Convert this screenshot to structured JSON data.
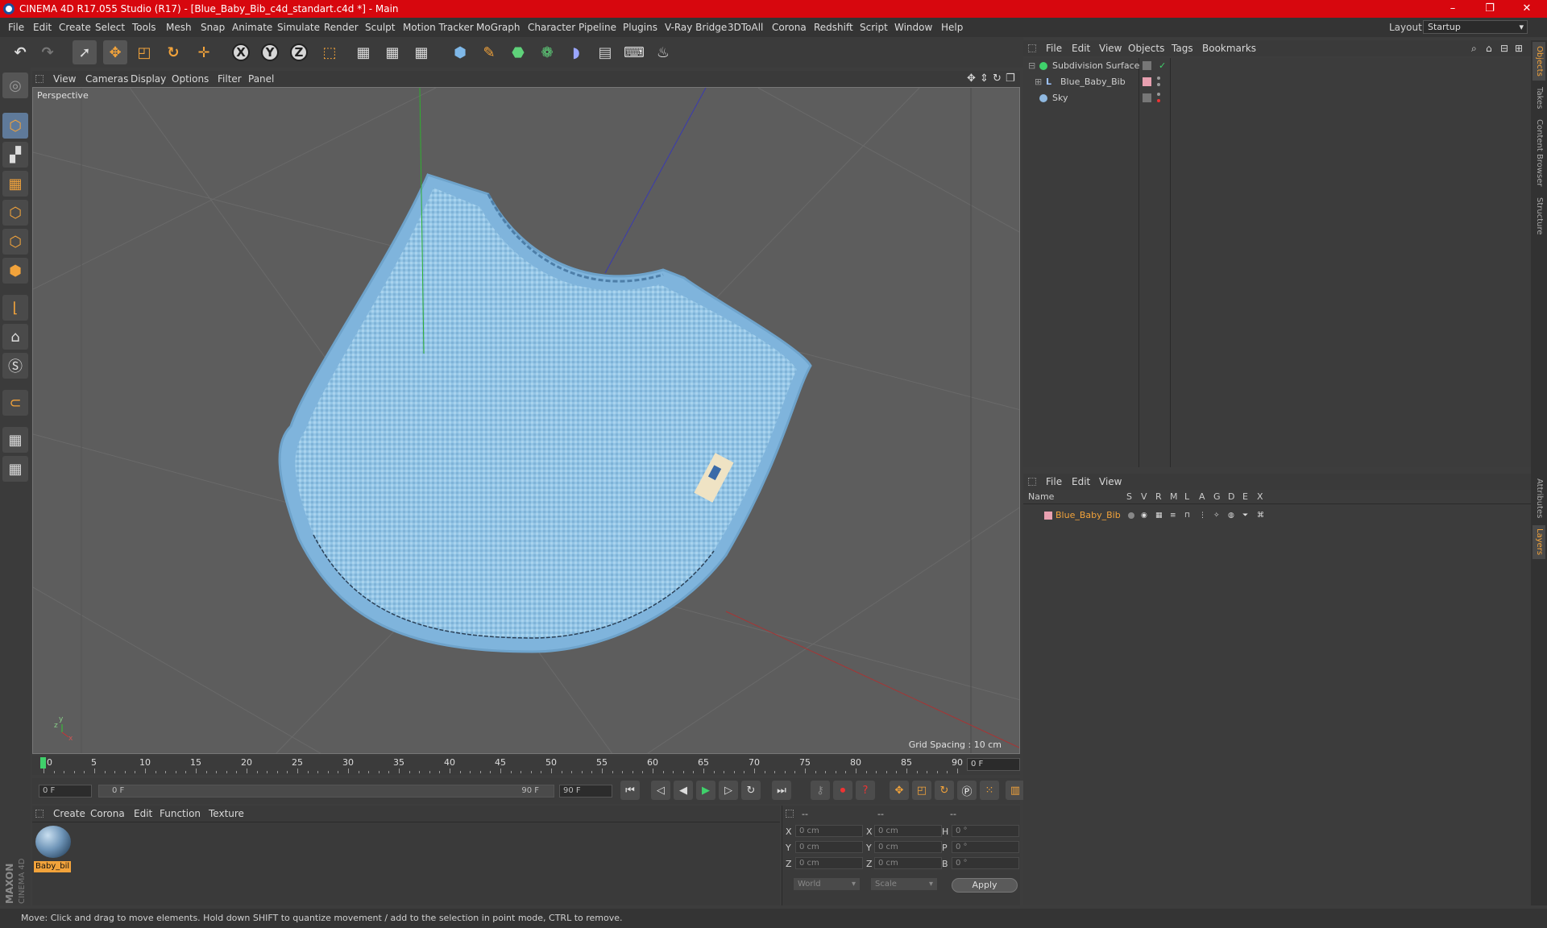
{
  "window": {
    "title": "CINEMA 4D R17.055 Studio (R17) - [Blue_Baby_Bib_c4d_standart.c4d *] - Main",
    "minimize": "–",
    "maximize": "❐",
    "close": "✕"
  },
  "menu": [
    "File",
    "Edit",
    "Create",
    "Select",
    "Tools",
    "Mesh",
    "Snap",
    "Animate",
    "Simulate",
    "Render",
    "Sculpt",
    "Motion Tracker",
    "MoGraph",
    "Character",
    "Pipeline",
    "Plugins",
    "V-Ray Bridge",
    "3DToAll",
    "Corona",
    "Redshift",
    "Script",
    "Window",
    "Help"
  ],
  "layout": {
    "label": "Layout:",
    "value": "Startup"
  },
  "toolbar": {
    "x_label": "X",
    "y_label": "Y",
    "z_label": "Z"
  },
  "viewport": {
    "menu": [
      "View",
      "Cameras",
      "Display",
      "Options",
      "Filter",
      "Panel"
    ],
    "label": "Perspective",
    "grid_spacing": "Grid Spacing : 10 cm"
  },
  "timeline": {
    "ticks": [
      "0",
      "5",
      "10",
      "15",
      "20",
      "25",
      "30",
      "35",
      "40",
      "45",
      "50",
      "55",
      "60",
      "65",
      "70",
      "75",
      "80",
      "85",
      "90"
    ],
    "current_frame": "0 F",
    "start": "0 F",
    "range_start": "0 F",
    "range_end": "90 F",
    "end": "90 F"
  },
  "material_manager": {
    "menu": [
      "Create",
      "Corona",
      "Edit",
      "Function",
      "Texture"
    ],
    "material_name": "Baby_bil"
  },
  "coordinates": {
    "headers": [
      "--",
      "--",
      "--"
    ],
    "rows": [
      {
        "a": "X",
        "av": "0 cm",
        "b": "X",
        "bv": "0 cm",
        "c": "H",
        "cv": "0 °"
      },
      {
        "a": "Y",
        "av": "0 cm",
        "b": "Y",
        "bv": "0 cm",
        "c": "P",
        "cv": "0 °"
      },
      {
        "a": "Z",
        "av": "0 cm",
        "b": "Z",
        "bv": "0 cm",
        "c": "B",
        "cv": "0 °"
      }
    ],
    "space": "World",
    "mode": "Scale",
    "apply": "Apply"
  },
  "object_manager": {
    "menu": [
      "File",
      "Edit",
      "View",
      "Objects",
      "Tags",
      "Bookmarks"
    ],
    "objects": [
      "Subdivision Surface",
      "Blue_Baby_Bib",
      "Sky"
    ]
  },
  "layer_manager": {
    "menu": [
      "File",
      "Edit",
      "View"
    ],
    "columns": [
      "Name",
      "S",
      "V",
      "R",
      "M",
      "L",
      "A",
      "G",
      "D",
      "E",
      "X"
    ],
    "layers": [
      "Blue_Baby_Bib"
    ]
  },
  "side_tabs": [
    "Objects",
    "Takes",
    "Content Browser",
    "Structure",
    "Attributes",
    "Layers"
  ],
  "status": "Move: Click and drag to move elements. Hold down SHIFT to quantize movement / add to the selection in point mode, CTRL to remove.",
  "colors": {
    "accent": "#f2a33b",
    "titlebar": "#d7070e",
    "bib": "#8fc3e6"
  }
}
